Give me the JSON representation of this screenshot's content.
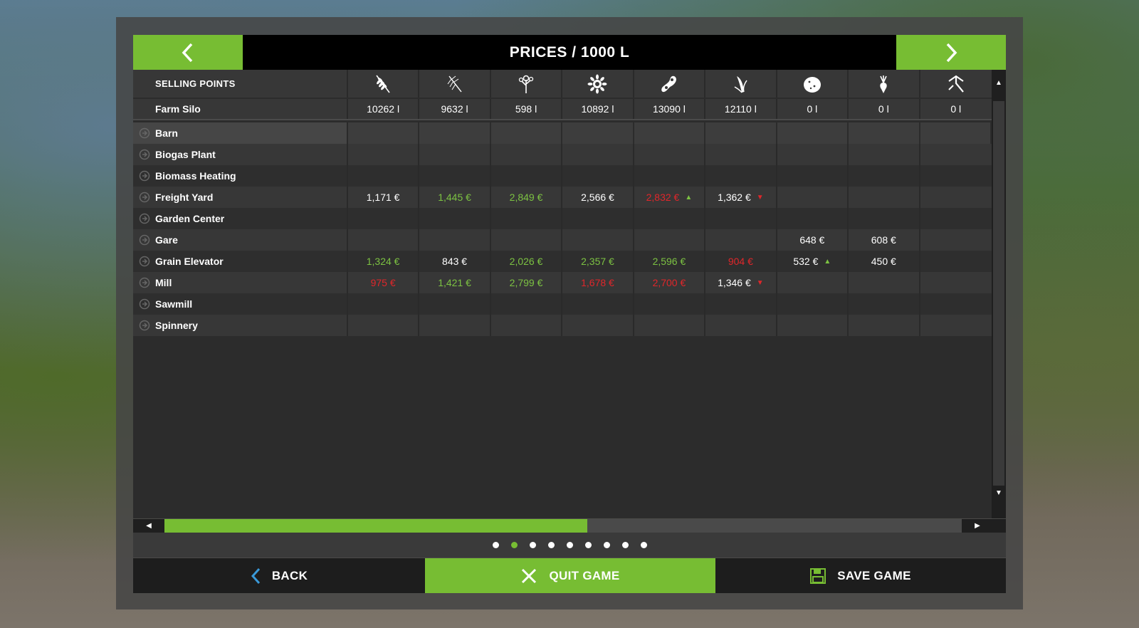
{
  "header": {
    "title": "PRICES / 1000 L"
  },
  "table": {
    "name_header": "SELLING POINTS",
    "fruit_icons": [
      "wheat-icon",
      "barley-icon",
      "canola-icon",
      "sunflower-icon",
      "soybean-icon",
      "maize-icon",
      "potato-icon",
      "sugarbeet-icon",
      "woodchips-icon"
    ],
    "farm_silo": {
      "name": "Farm Silo",
      "values": [
        "10262 l",
        "9632 l",
        "598 l",
        "10892 l",
        "13090 l",
        "12110 l",
        "0 l",
        "0 l",
        "0 l"
      ]
    },
    "rows": [
      {
        "name": "Barn",
        "selected": true,
        "cells": [
          "",
          "",
          "",
          "",
          "",
          "",
          "",
          "",
          ""
        ]
      },
      {
        "name": "Biogas Plant",
        "cells": [
          "",
          "",
          "",
          "",
          "",
          "",
          "",
          "",
          ""
        ]
      },
      {
        "name": "Biomass Heating",
        "cells": [
          "",
          "",
          "",
          "",
          "",
          "",
          "",
          "",
          ""
        ]
      },
      {
        "name": "Freight Yard",
        "cells": [
          "1,171 €",
          "1,445 €",
          "2,849 €",
          "2,566 €",
          "2,832 €",
          "1,362 €",
          "",
          "",
          ""
        ],
        "colors": [
          "white",
          "green",
          "green",
          "white",
          "red",
          "white",
          "",
          "",
          ""
        ],
        "trends": [
          "",
          "",
          "",
          "",
          "up",
          "down",
          "",
          "",
          ""
        ]
      },
      {
        "name": "Garden Center",
        "cells": [
          "",
          "",
          "",
          "",
          "",
          "",
          "",
          "",
          ""
        ]
      },
      {
        "name": "Gare",
        "cells": [
          "",
          "",
          "",
          "",
          "",
          "",
          "648 €",
          "608 €",
          ""
        ],
        "colors": [
          "",
          "",
          "",
          "",
          "",
          "",
          "white",
          "white",
          ""
        ]
      },
      {
        "name": "Grain Elevator",
        "cells": [
          "1,324 €",
          "843 €",
          "2,026 €",
          "2,357 €",
          "2,596 €",
          "904 €",
          "532 €",
          "450 €",
          ""
        ],
        "colors": [
          "green",
          "white",
          "green",
          "green",
          "green",
          "red",
          "white",
          "white",
          ""
        ],
        "trends": [
          "",
          "",
          "",
          "",
          "",
          "",
          "up",
          "",
          ""
        ]
      },
      {
        "name": "Mill",
        "cells": [
          "975 €",
          "1,421 €",
          "2,799 €",
          "1,678 €",
          "2,700 €",
          "1,346 €",
          "",
          "",
          ""
        ],
        "colors": [
          "red",
          "green",
          "green",
          "red",
          "red",
          "white",
          "",
          "",
          ""
        ],
        "trends": [
          "",
          "",
          "",
          "",
          "",
          "down",
          "",
          "",
          ""
        ]
      },
      {
        "name": "Sawmill",
        "cells": [
          "",
          "",
          "",
          "",
          "",
          "",
          "",
          "",
          ""
        ]
      },
      {
        "name": "Spinnery",
        "cells": [
          "",
          "",
          "",
          "",
          "",
          "",
          "",
          "",
          ""
        ]
      }
    ]
  },
  "scroll": {
    "horizontal_fraction": 0.53
  },
  "pager": {
    "count": 9,
    "active_index": 1
  },
  "footer": {
    "back_label": "BACK",
    "quit_label": "QUIT GAME",
    "save_label": "SAVE GAME"
  },
  "colors": {
    "accent": "#77bd33",
    "price_up": "#7cc242",
    "price_down": "#e0262a",
    "back_icon": "#3a9ad9"
  }
}
